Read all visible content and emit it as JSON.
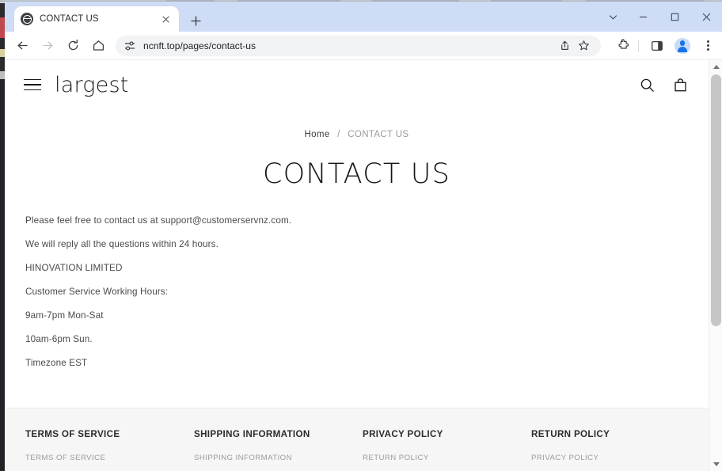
{
  "browser": {
    "tab": {
      "title": "CONTACT US",
      "favicon": "globe-icon",
      "close": "×"
    },
    "new_tab_label": "+",
    "window_controls": {
      "tab_search": "⌄",
      "minimize": "—",
      "maximize": "□",
      "close": "✕"
    },
    "toolbar": {
      "back": "←",
      "forward": "→",
      "reload": "⟳",
      "home": "⌂",
      "site_info": "tune-icon",
      "url": "ncnft.top/pages/contact-us",
      "share": "share-icon",
      "bookmark": "☆",
      "extensions": "puzzle-icon",
      "side_panel": "side-panel-icon",
      "profile": "profile-avatar",
      "menu": "⋮"
    }
  },
  "site": {
    "header": {
      "menu_label": "menu",
      "brand": "largest",
      "search_label": "Search",
      "cart_label": "Cart"
    },
    "breadcrumb": {
      "home": "Home",
      "separator": "/",
      "current": "CONTACT US"
    },
    "title": "CONTACT US",
    "body": [
      "Please feel free to contact us at support@customerservnz.com.",
      "We will reply all the questions within 24 hours.",
      "HINOVATION LIMITED",
      "Customer Service Working Hours:",
      "9am-7pm Mon-Sat",
      "10am-6pm Sun.",
      "Timezone EST"
    ],
    "footer": {
      "columns": [
        {
          "heading": "TERMS OF SERVICE",
          "links": [
            "TERMS OF SERVICE"
          ]
        },
        {
          "heading": "SHIPPING INFORMATION",
          "links": [
            "SHIPPING INFORMATION"
          ]
        },
        {
          "heading": "PRIVACY POLICY",
          "links": [
            "RETURN POLICY"
          ]
        },
        {
          "heading": "RETURN POLICY",
          "links": [
            "PRIVACY POLICY"
          ]
        }
      ]
    }
  },
  "colors": {
    "tab_strip": "#cfdcf5",
    "page_bg": "#ffffff",
    "footer_bg": "#f6f6f6",
    "text": "#4a4a4a",
    "muted": "#9a9a9a",
    "accent": "#1a73e8"
  }
}
